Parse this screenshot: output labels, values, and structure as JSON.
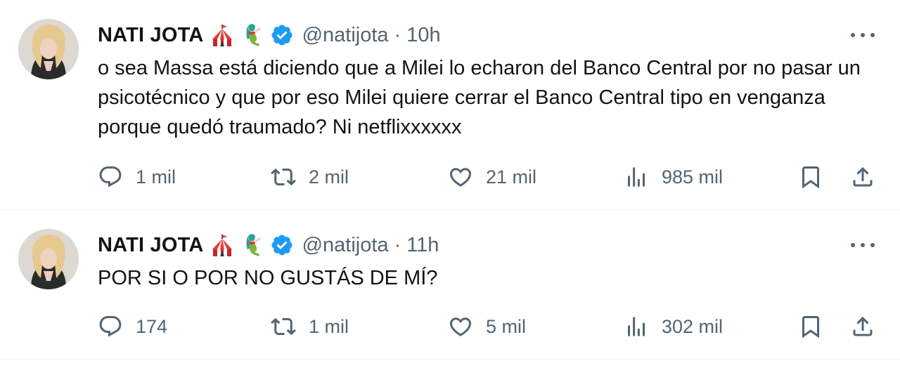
{
  "colors": {
    "text": "#0f1419",
    "secondary": "#536471",
    "verified": "#1d9bf0",
    "divider": "#eff3f4"
  },
  "tweets": [
    {
      "author_name": "NATI JOTA",
      "emojis": [
        "circus-tent",
        "mermaid"
      ],
      "verified": true,
      "handle": "@natijota",
      "separator": "·",
      "time": "10h",
      "text": "o sea Massa está diciendo que a Milei lo echaron del Banco Central por no pasar un psicotécnico y que por eso Milei quiere cerrar el Banco Central tipo en venganza porque quedó traumado? Ni netflixxxxxx",
      "replies": "1 mil",
      "retweets": "2 mil",
      "likes": "21 mil",
      "views": "985 mil"
    },
    {
      "author_name": "NATI JOTA",
      "emojis": [
        "circus-tent",
        "mermaid"
      ],
      "verified": true,
      "handle": "@natijota",
      "separator": "·",
      "time": "11h",
      "text": "POR SI O POR NO GUSTÁS DE MÍ?",
      "replies": "174",
      "retweets": "1 mil",
      "likes": "5 mil",
      "views": "302 mil"
    }
  ]
}
